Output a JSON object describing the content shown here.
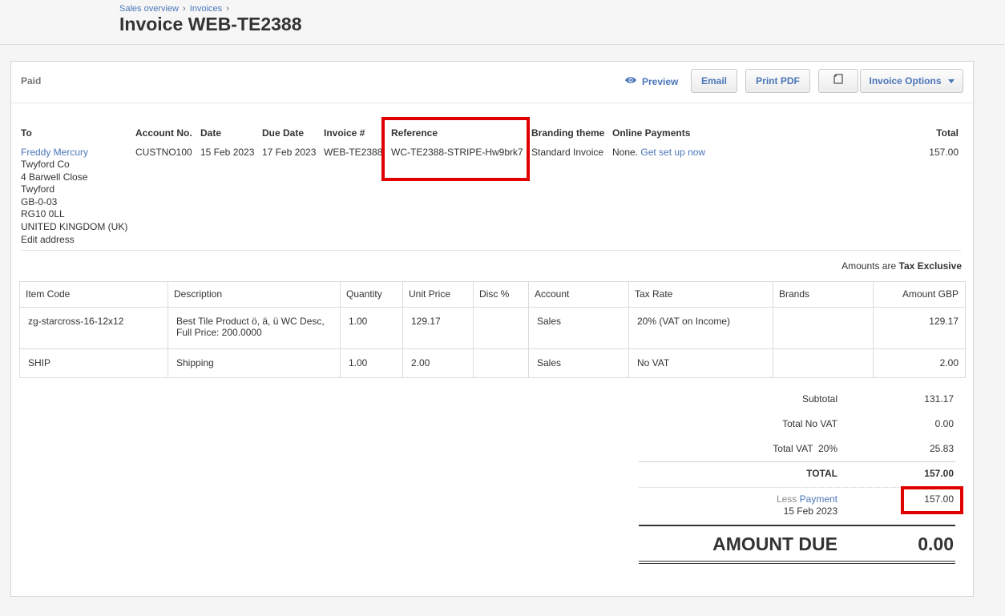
{
  "breadcrumb": {
    "sales_overview": "Sales overview",
    "invoices": "Invoices",
    "separator": "›"
  },
  "page_title": "Invoice WEB-TE2388",
  "status": "Paid",
  "toolbar": {
    "preview_label": "Preview",
    "email_label": "Email",
    "print_pdf_label": "Print PDF",
    "options_label": "Invoice Options"
  },
  "icons": [
    "eye-icon",
    "copy-icon",
    "chevron-down-icon"
  ],
  "details": {
    "to_label": "To",
    "account_no_label": "Account No.",
    "account_no": "CUSTNO100",
    "date_label": "Date",
    "date": "15 Feb 2023",
    "due_date_label": "Due Date",
    "due_date": "17 Feb 2023",
    "invoice_no_label": "Invoice #",
    "invoice_no": "WEB-TE2388",
    "reference_label": "Reference",
    "reference": "WC-TE2388-STRIPE-Hw9brk7",
    "branding_label": "Branding theme",
    "branding": "Standard Invoice",
    "online_payments_label": "Online Payments",
    "online_payments_prefix": "None.",
    "online_payments_link": "Get set up now",
    "total_label": "Total",
    "total": "157.00"
  },
  "contact": {
    "name": "Freddy Mercury",
    "address_lines": [
      "Twyford Co",
      "4 Barwell Close",
      "Twyford",
      "GB-0-03",
      "RG10 0LL",
      "UNITED KINGDOM (UK)"
    ],
    "edit_address": "Edit address"
  },
  "amounts_are": {
    "prefix": "Amounts are",
    "value": "Tax Exclusive"
  },
  "table": {
    "headers": [
      "Item Code",
      "Description",
      "Quantity",
      "Unit Price",
      "Disc %",
      "Account",
      "Tax Rate",
      "Brands",
      "Amount GBP"
    ],
    "rows": [
      {
        "item_code": "zg-starcross-16-12x12",
        "description_line1": "Best Tile Product ö, ä, ü WC Desc,",
        "description_line2": "Full Price: 200.0000",
        "quantity": "1.00",
        "unit_price": "129.17",
        "disc": "",
        "account": "Sales",
        "tax_rate": "20% (VAT on Income)",
        "brands": "",
        "amount": "129.17"
      },
      {
        "item_code": "SHIP",
        "description_line1": "Shipping",
        "description_line2": "",
        "quantity": "1.00",
        "unit_price": "2.00",
        "disc": "",
        "account": "Sales",
        "tax_rate": "No VAT",
        "brands": "",
        "amount": "2.00"
      }
    ]
  },
  "totals": {
    "subtotal_label": "Subtotal",
    "subtotal": "131.17",
    "no_vat_label": "Total No VAT",
    "no_vat": "0.00",
    "vat_label": "Total VAT  20%",
    "vat": "25.83",
    "total_label": "TOTAL",
    "total": "157.00",
    "less_label": "Less",
    "payment_link": "Payment",
    "payment_date": "15 Feb 2023",
    "payment": "157.00",
    "amount_due_label": "AMOUNT DUE",
    "amount_due": "0.00"
  },
  "colors": {
    "link": "#4a76b8",
    "highlight_box": "#e00000"
  }
}
